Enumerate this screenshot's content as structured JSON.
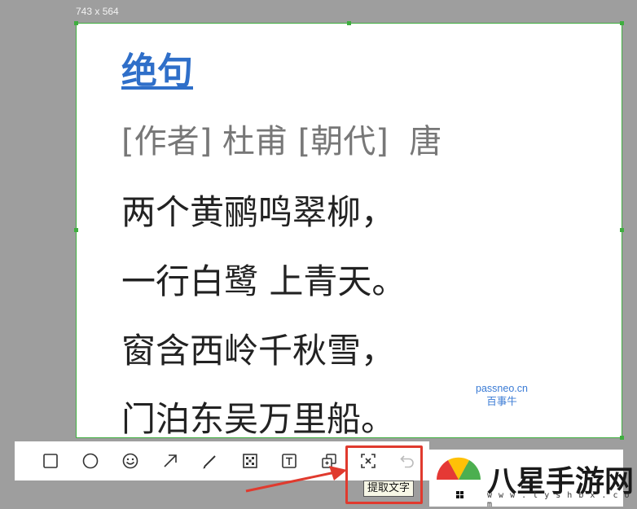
{
  "capture": {
    "size_label": "743 x 564"
  },
  "poem": {
    "title": "绝句",
    "meta": "[作者] 杜甫 [朝代]  唐",
    "lines": [
      "两个黄鹂鸣翠柳，",
      "一行白鹭 上青天。",
      "窗含西岭千秋雪，",
      "门泊东吴万里船。"
    ]
  },
  "watermark": {
    "line1": "passneo.cn",
    "line2": "百事牛"
  },
  "toolbar": {
    "tools": [
      "rectangle-icon",
      "ellipse-icon",
      "emoji-icon",
      "arrow-icon",
      "pen-icon",
      "mosaic-icon",
      "text-icon",
      "pin-icon",
      "extract-text-icon",
      "undo-icon"
    ],
    "tooltip": "提取文字"
  },
  "logo": {
    "text": "八星手游网",
    "sub": "w w w . l y s h b x . c o m"
  },
  "colors": {
    "selection": "#3fae3f",
    "highlight": "#e03a2e",
    "title": "#2f6fc9"
  }
}
